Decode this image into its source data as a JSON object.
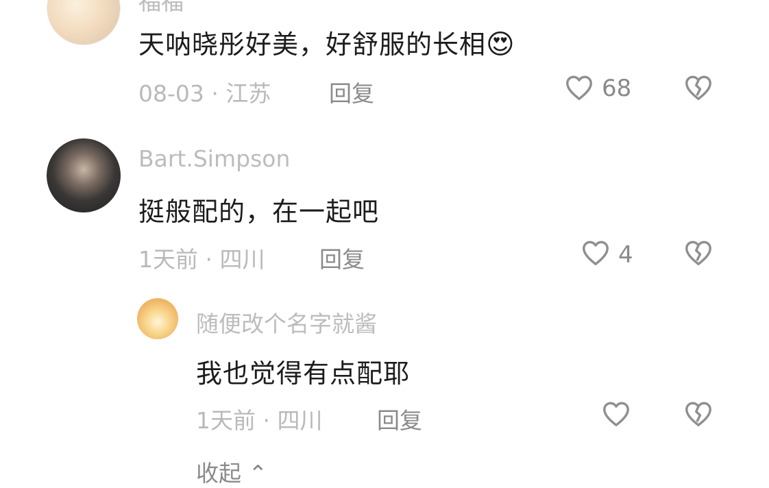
{
  "comments": [
    {
      "username": "福福",
      "text": "天呐晓彤好美，好舒服的长相",
      "emoji": "😍",
      "date_location": "08-03 · 江苏",
      "reply_label": "回复",
      "likes": "68"
    },
    {
      "username": "Bart.Simpson",
      "text": "挺般配的，在一起吧",
      "date_location": "1天前 · 四川",
      "reply_label": "回复",
      "likes": "4"
    },
    {
      "username": "随便改个名字就酱",
      "text": "我也觉得有点配耶",
      "date_location": "1天前 · 四川",
      "reply_label": "回复",
      "likes": ""
    }
  ],
  "collapse_label": "收起 ⌃",
  "icons": {
    "like": "heart-outline-icon",
    "dislike": "broken-heart-icon"
  },
  "colors": {
    "primary_text": "#1c1c1c",
    "secondary_text": "#b9b9b9",
    "action_text": "#8a8a8a",
    "icon": "#8f8f8f"
  }
}
